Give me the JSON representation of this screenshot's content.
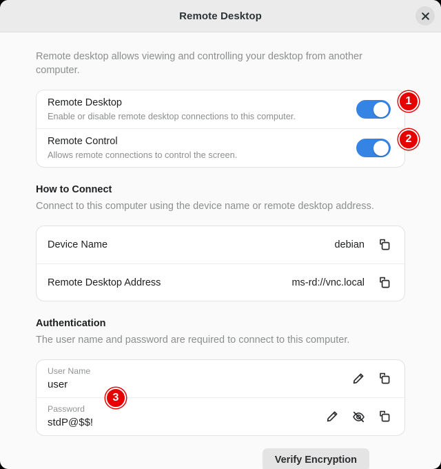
{
  "window": {
    "title": "Remote Desktop",
    "close_icon": "close-icon"
  },
  "intro": "Remote desktop allows viewing and controlling your desktop from another computer.",
  "toggles": [
    {
      "title": "Remote Desktop",
      "subtitle": "Enable or disable remote desktop connections to this computer.",
      "state": "on",
      "badge": "1"
    },
    {
      "title": "Remote Control",
      "subtitle": "Allows remote connections to control the screen.",
      "state": "on",
      "badge": "2"
    }
  ],
  "how_to_connect": {
    "title": "How to Connect",
    "subtitle": "Connect to this computer using the device name or remote desktop address.",
    "rows": [
      {
        "label": "Device Name",
        "value": "debian",
        "copy_icon": "copy-icon"
      },
      {
        "label": "Remote Desktop Address",
        "value": "ms-rd://vnc.local",
        "copy_icon": "copy-icon"
      }
    ]
  },
  "authentication": {
    "title": "Authentication",
    "subtitle": "The user name and password are required to connect to this computer.",
    "username": {
      "caption": "User Name",
      "value": "user",
      "edit_icon": "pencil-icon",
      "copy_icon": "copy-icon"
    },
    "password": {
      "caption": "Password",
      "value": "stdP@$$!",
      "badge": "3",
      "edit_icon": "pencil-icon",
      "reveal_icon": "eye-off-icon",
      "copy_icon": "copy-icon"
    }
  },
  "footer": {
    "verify_label": "Verify Encryption"
  },
  "colors": {
    "accent": "#3584e4",
    "badge": "#e60000",
    "window_bg": "#fafafa",
    "card_bg": "#ffffff",
    "titlebar_bg": "#ebebeb"
  }
}
